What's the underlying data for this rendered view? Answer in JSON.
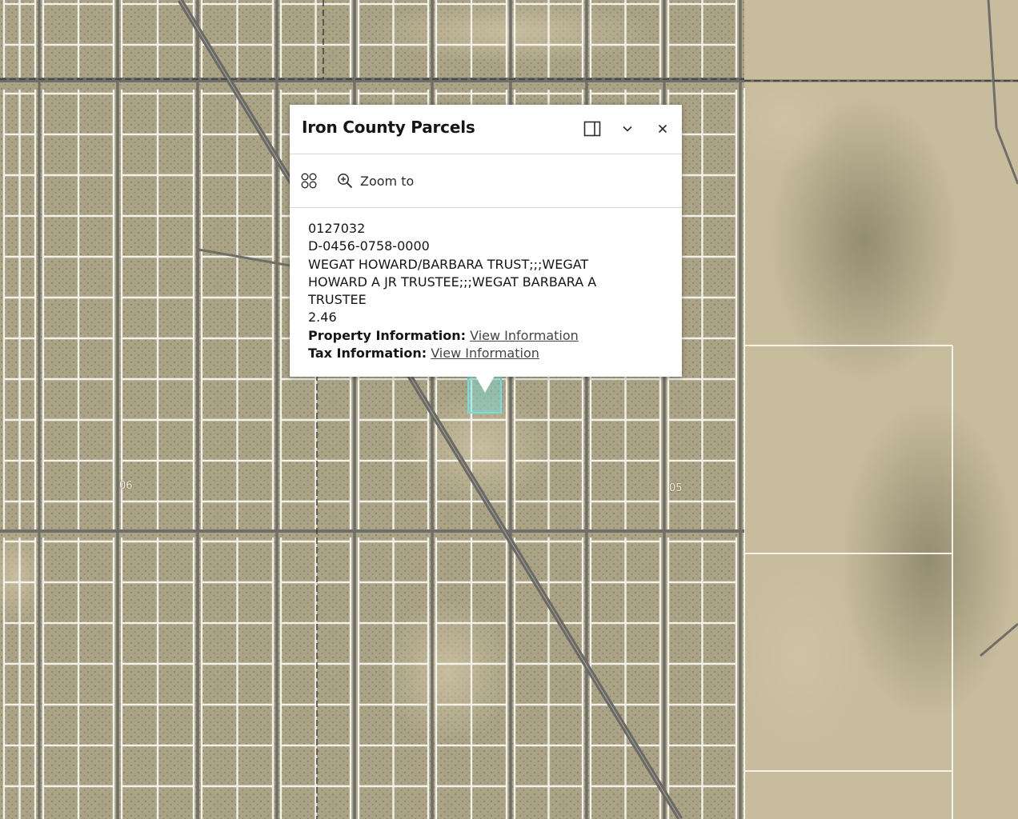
{
  "map": {
    "section_labels": [
      "06",
      "05"
    ]
  },
  "popup": {
    "title": "Iron County Parcels",
    "buttons": {
      "dock": "dock-icon",
      "collapse": "chevron-down-icon",
      "close": "close-icon"
    },
    "actions": {
      "options_icon": "more-options-icon",
      "zoom_icon": "zoom-in-icon",
      "zoom_label": "Zoom to"
    },
    "content": {
      "parcel_id": "0127032",
      "parcel_number": "D-0456-0758-0000",
      "owner": "WEGAT HOWARD/BARBARA TRUST;;;WEGAT HOWARD A JR TRUSTEE;;;WEGAT BARBARA A TRUSTEE",
      "acreage": "2.46",
      "property_label": "Property Information:",
      "property_link": "View Information",
      "tax_label": "Tax Information:",
      "tax_link": "View Information"
    }
  },
  "colors": {
    "highlight": "#74dfe0",
    "parcel_lines": "#f4f4ee",
    "roads": "#6d6d68"
  }
}
